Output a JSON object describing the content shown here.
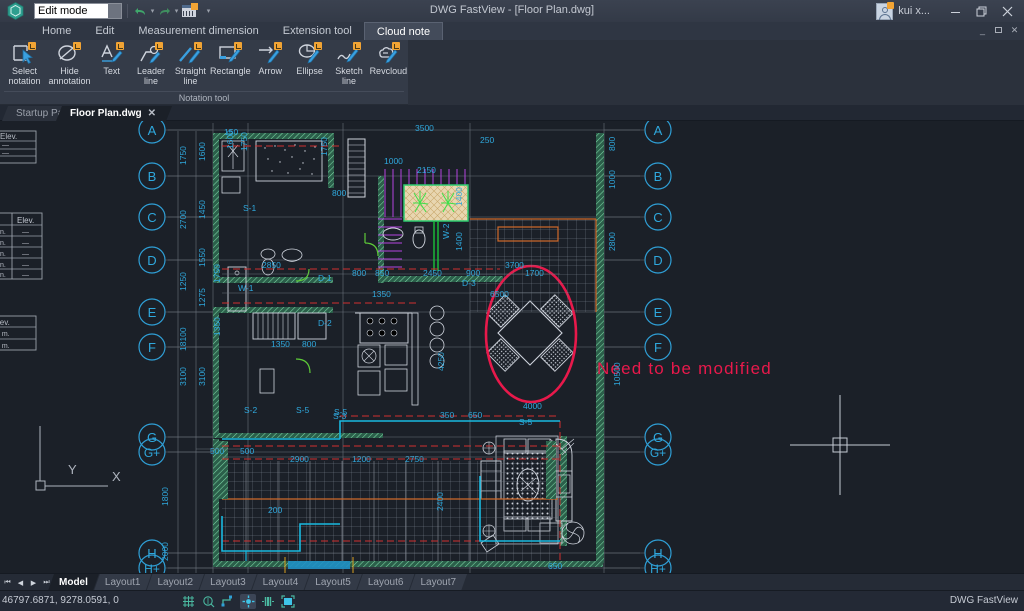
{
  "window": {
    "title": "DWG FastView - [Floor Plan.dwg]",
    "user": "kui x...",
    "minimize": "—",
    "restore": "❐",
    "close": "✕",
    "sub_minimize": "_",
    "sub_restore": "❐",
    "sub_close": "✕"
  },
  "quick_access": {
    "mode_value": "Edit mode",
    "mode_placeholder": "Edit mode",
    "undo": "undo-icon",
    "undo_menu": "▾",
    "redo": "redo-icon",
    "redo_menu": "▾",
    "measure": "measure-icon",
    "customize": "▾"
  },
  "menu": {
    "tabs": [
      {
        "label": "Home",
        "active": false
      },
      {
        "label": "Edit",
        "active": false
      },
      {
        "label": "Measurement dimension",
        "active": false
      },
      {
        "label": "Extension tool",
        "active": false
      },
      {
        "label": "Cloud note",
        "active": true
      }
    ]
  },
  "ribbon": {
    "panel_title": "Notation tool",
    "items": [
      {
        "label": "Select\nnotation",
        "icon": "select-notation-icon"
      },
      {
        "label": "Hide\nannotation",
        "icon": "hide-annotation-icon"
      },
      {
        "label": "Text",
        "icon": "text-icon"
      },
      {
        "label": "Leader\nline",
        "icon": "leader-line-icon"
      },
      {
        "label": "Straight\nline",
        "icon": "straight-line-icon"
      },
      {
        "label": "Rectangle",
        "icon": "rectangle-icon"
      },
      {
        "label": "Arrow",
        "icon": "arrow-icon"
      },
      {
        "label": "Ellipse",
        "icon": "ellipse-icon"
      },
      {
        "label": "Sketch\nline",
        "icon": "sketch-line-icon"
      },
      {
        "label": "Revcloud",
        "icon": "revcloud-icon"
      }
    ]
  },
  "doc_tabs": [
    {
      "label": "Startup Page",
      "active": false,
      "closable": false
    },
    {
      "label": "Floor Plan.dwg",
      "active": true,
      "closable": true,
      "close": "✕"
    }
  ],
  "layout_tabs": [
    {
      "label": "Model",
      "active": true
    },
    {
      "label": "Layout1",
      "active": false
    },
    {
      "label": "Layout2",
      "active": false
    },
    {
      "label": "Layout3",
      "active": false
    },
    {
      "label": "Layout4",
      "active": false
    },
    {
      "label": "Layout5",
      "active": false
    },
    {
      "label": "Layout6",
      "active": false
    },
    {
      "label": "Layout7",
      "active": false
    }
  ],
  "nav_buttons": [
    "⏮",
    "◀",
    "▶",
    "⏭"
  ],
  "status": {
    "coordinates": "46797.6871, 9278.0591, 0",
    "brand": "DWG FastView",
    "toggles": [
      {
        "name": "grid-icon",
        "active": false
      },
      {
        "name": "snap-zoom-icon",
        "active": false
      },
      {
        "name": "ortho-icon",
        "active": false
      },
      {
        "name": "object-snap-icon",
        "active": true
      },
      {
        "name": "lineweight-icon",
        "active": false
      },
      {
        "name": "fullscreen-icon",
        "active": false
      }
    ]
  },
  "drawing": {
    "annotation": {
      "text": "Need to be modified",
      "color": "#e8194b",
      "ellipse_color": "#e8194b"
    },
    "ucs": {
      "x_label": "X",
      "y_label": "Y"
    },
    "grid_labels_left": [
      "A",
      "B",
      "C",
      "D",
      "E",
      "F",
      "G",
      "G+",
      "H",
      "H+"
    ],
    "grid_labels_right": [
      "A",
      "B",
      "C",
      "D",
      "E",
      "F",
      "G",
      "G+",
      "H",
      "H+"
    ],
    "room_tags": [
      "S-1",
      "S-2",
      "S-3",
      "S-5",
      "W-1",
      "W-2",
      "D-1",
      "D-2",
      "D-3"
    ],
    "dimensions_top": [
      "150",
      "3500",
      "250",
      "1000",
      "2150",
      "800",
      "1400",
      "1750",
      "1600"
    ],
    "dimensions_left": [
      "1600",
      "1750",
      "1450",
      "2700",
      "550",
      "1550",
      "1250",
      "1750",
      "1350",
      "1275",
      "3100",
      "1800",
      "500",
      "2000",
      "18100"
    ],
    "dimensions_mid": [
      "800",
      "850",
      "2450",
      "900",
      "1700",
      "2850",
      "1350",
      "6500",
      "4000",
      "350",
      "650"
    ],
    "dimensions_bottom": [
      "2900",
      "1200",
      "2750",
      "500",
      "200",
      "2400",
      "650",
      "10500",
      "2800",
      "3700",
      "600"
    ],
    "colors": {
      "background": "#1b2028",
      "dimension_text": "#2fa8dd",
      "grid_bubble": "#2f9fd6",
      "wall": "#c8cdd6",
      "hatch_green": "#2e7d5b",
      "door_green": "#5ecb38",
      "stair_purple": "#b444e0",
      "red_dash": "#d03030",
      "cyan_line": "#19b9e0",
      "orange_line": "#d06a2a"
    }
  }
}
